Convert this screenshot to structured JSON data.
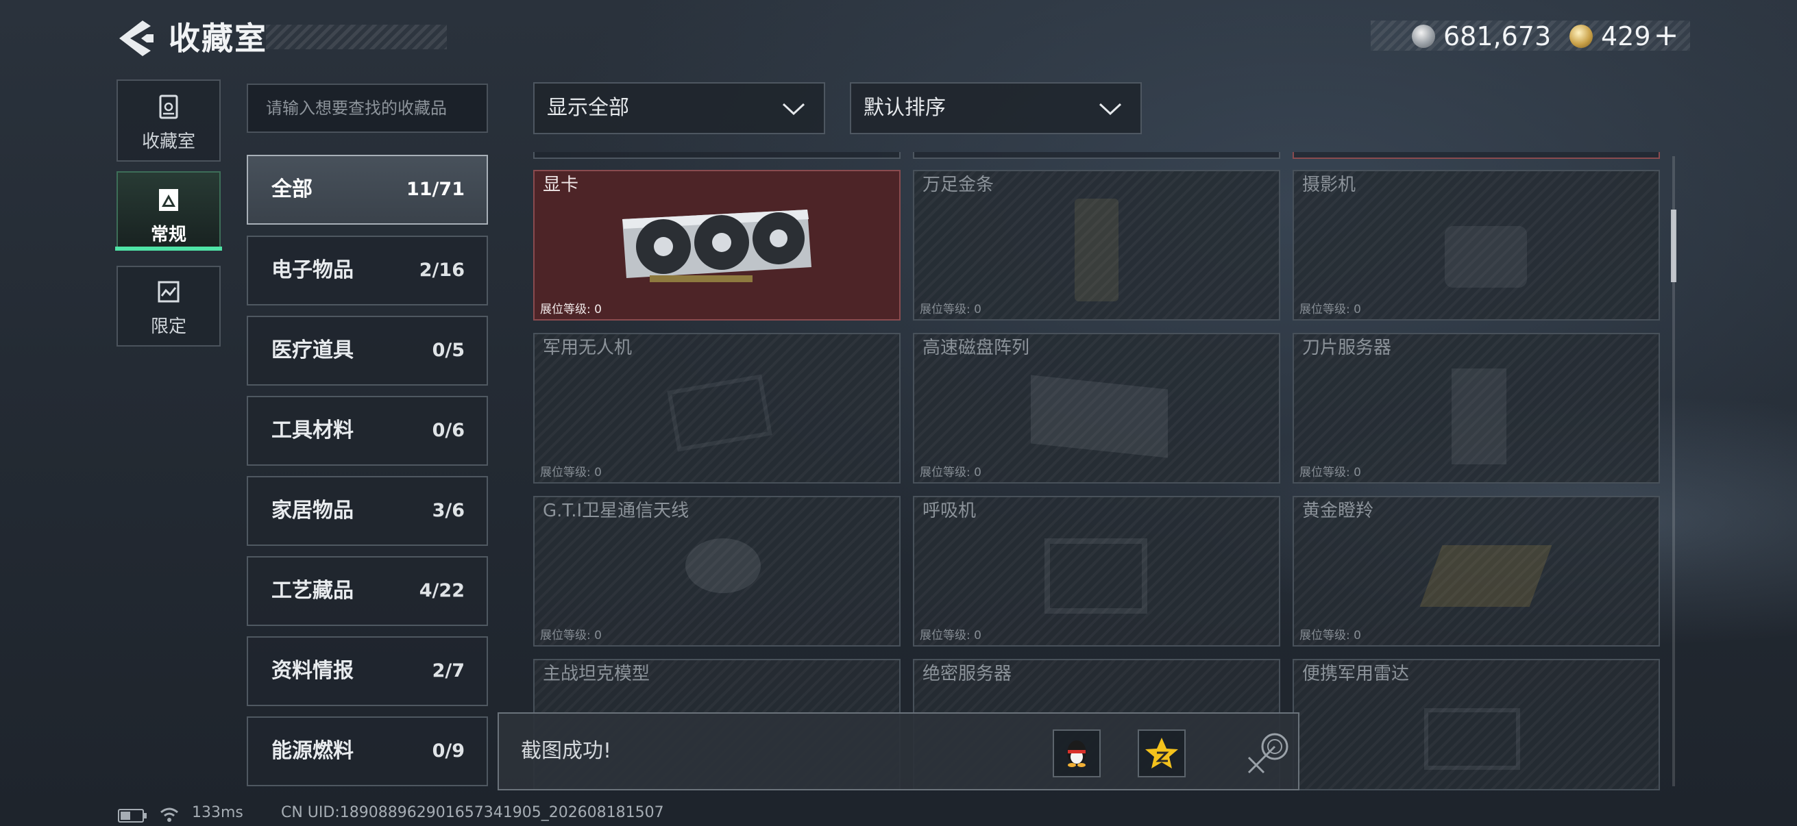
{
  "header": {
    "title": "收藏室",
    "silver_amount": "681,673",
    "gold_amount": "429",
    "add_label": "+"
  },
  "left_nav": [
    {
      "label": "收藏室",
      "icon": "trash-bin-icon",
      "active": false
    },
    {
      "label": "常规",
      "icon": "gallery-icon",
      "active": true
    },
    {
      "label": "限定",
      "icon": "ticket-icon",
      "active": false
    }
  ],
  "search": {
    "placeholder": "请输入想要查找的收藏品",
    "value": ""
  },
  "categories": [
    {
      "label": "全部",
      "count": "11/71",
      "active": true
    },
    {
      "label": "电子物品",
      "count": "2/16"
    },
    {
      "label": "医疗道具",
      "count": "0/5"
    },
    {
      "label": "工具材料",
      "count": "0/6"
    },
    {
      "label": "家居物品",
      "count": "3/6"
    },
    {
      "label": "工艺藏品",
      "count": "4/22"
    },
    {
      "label": "资料情报",
      "count": "2/7"
    },
    {
      "label": "能源燃料",
      "count": "0/9"
    }
  ],
  "filters": {
    "show": "显示全部",
    "sort": "默认排序"
  },
  "items": [
    {
      "name": "显卡",
      "level": "展位等级: 0",
      "owned": true,
      "icon": "graphics-card-icon"
    },
    {
      "name": "万足金条",
      "level": "展位等级: 0",
      "owned": false,
      "icon": "gold-bar-icon"
    },
    {
      "name": "摄影机",
      "level": "展位等级: 0",
      "owned": false,
      "icon": "camera-icon"
    },
    {
      "name": "军用无人机",
      "level": "展位等级: 0",
      "owned": false,
      "icon": "drone-icon"
    },
    {
      "name": "高速磁盘阵列",
      "level": "展位等级: 0",
      "owned": false,
      "icon": "disk-array-icon"
    },
    {
      "name": "刀片服务器",
      "level": "展位等级: 0",
      "owned": false,
      "icon": "blade-server-icon"
    },
    {
      "name": "G.T.I卫星通信天线",
      "level": "展位等级: 0",
      "owned": false,
      "icon": "satellite-dish-icon"
    },
    {
      "name": "呼吸机",
      "level": "展位等级: 0",
      "owned": false,
      "icon": "ventilator-icon"
    },
    {
      "name": "黄金瞪羚",
      "level": "展位等级: 0",
      "owned": false,
      "icon": "gazelle-statue-icon"
    },
    {
      "name": "主战坦克模型",
      "level": "",
      "owned": false,
      "icon": "tank-model-icon"
    },
    {
      "name": "绝密服务器",
      "level": "",
      "owned": false,
      "icon": "server-icon"
    },
    {
      "name": "便携军用雷达",
      "level": "",
      "owned": false,
      "icon": "radar-icon"
    }
  ],
  "toast": {
    "message": "截图成功!"
  },
  "status_bar": {
    "ping": "133ms",
    "uid": "CN UID:18908896290165734190​5_202608181507"
  },
  "colors": {
    "accent": "#4fe3a6",
    "owned_card": "#4d2427"
  }
}
